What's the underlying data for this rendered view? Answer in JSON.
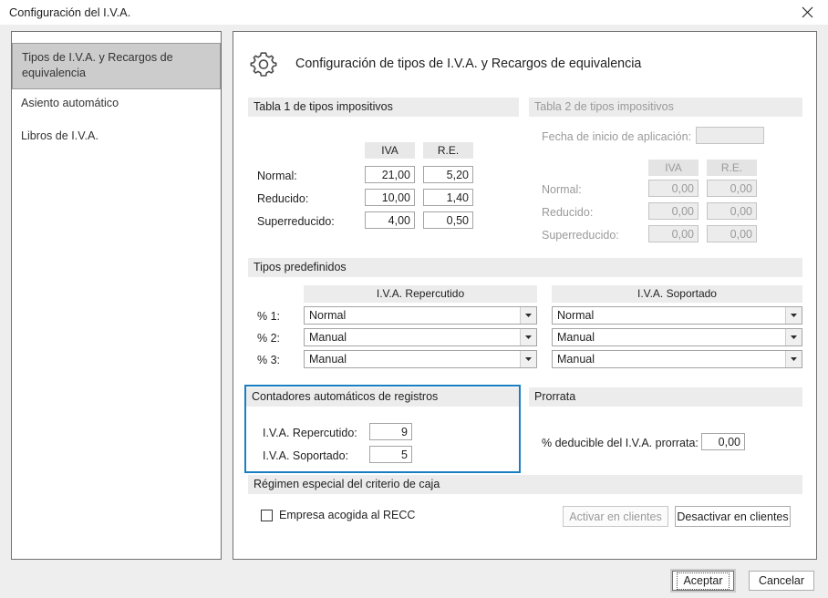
{
  "window": {
    "title": "Configuración del I.V.A.",
    "close_icon": "close-icon"
  },
  "sidebar": {
    "items": [
      {
        "label": "Tipos de I.V.A. y Recargos de equivalencia",
        "active": true
      },
      {
        "label": "Asiento automático",
        "active": false
      },
      {
        "label": "Libros de I.V.A.",
        "active": false
      }
    ]
  },
  "panel": {
    "icon": "gear-icon",
    "title": "Configuración de tipos de I.V.A. y Recargos de equivalencia"
  },
  "tabla1": {
    "header": "Tabla 1 de tipos impositivos",
    "col_iva": "IVA",
    "col_re": "R.E.",
    "rows": [
      {
        "label": "Normal:",
        "iva": "21,00",
        "re": "5,20"
      },
      {
        "label": "Reducido:",
        "iva": "10,00",
        "re": "1,40"
      },
      {
        "label": "Superreducido:",
        "iva": "4,00",
        "re": "0,50"
      }
    ]
  },
  "tabla2": {
    "header": "Tabla 2 de tipos impositivos",
    "fecha_label": "Fecha de inicio de aplicación:",
    "fecha_value": "",
    "col_iva": "IVA",
    "col_re": "R.E.",
    "rows": [
      {
        "label": "Normal:",
        "iva": "0,00",
        "re": "0,00"
      },
      {
        "label": "Reducido:",
        "iva": "0,00",
        "re": "0,00"
      },
      {
        "label": "Superreducido:",
        "iva": "0,00",
        "re": "0,00"
      }
    ]
  },
  "tipos_predefinidos": {
    "header": "Tipos predefinidos",
    "col_repercutido": "I.V.A. Repercutido",
    "col_soportado": "I.V.A. Soportado",
    "rows": [
      {
        "label": "% 1:",
        "repercutido": "Normal",
        "soportado": "Normal"
      },
      {
        "label": "% 2:",
        "repercutido": "Manual",
        "soportado": "Manual"
      },
      {
        "label": "% 3:",
        "repercutido": "Manual",
        "soportado": "Manual"
      }
    ],
    "arrow_icon": "chevron-down-icon"
  },
  "contadores": {
    "header": "Contadores automáticos de registros",
    "highlight_color": "#1a7fc1",
    "rows": [
      {
        "label": "I.V.A. Repercutido:",
        "value": "9"
      },
      {
        "label": "I.V.A. Soportado:",
        "value": "5"
      }
    ]
  },
  "prorrata": {
    "header": "Prorrata",
    "label": "% deducible del I.V.A. prorrata:",
    "value": "0,00"
  },
  "recc": {
    "header": "Régimen especial del criterio de caja",
    "checkbox_label": "Empresa acogida al RECC",
    "checked": false,
    "activar_label": "Activar en clientes",
    "activar_enabled": false,
    "desactivar_label": "Desactivar en clientes",
    "desactivar_enabled": true
  },
  "footer": {
    "accept_label": "Aceptar",
    "cancel_label": "Cancelar"
  }
}
